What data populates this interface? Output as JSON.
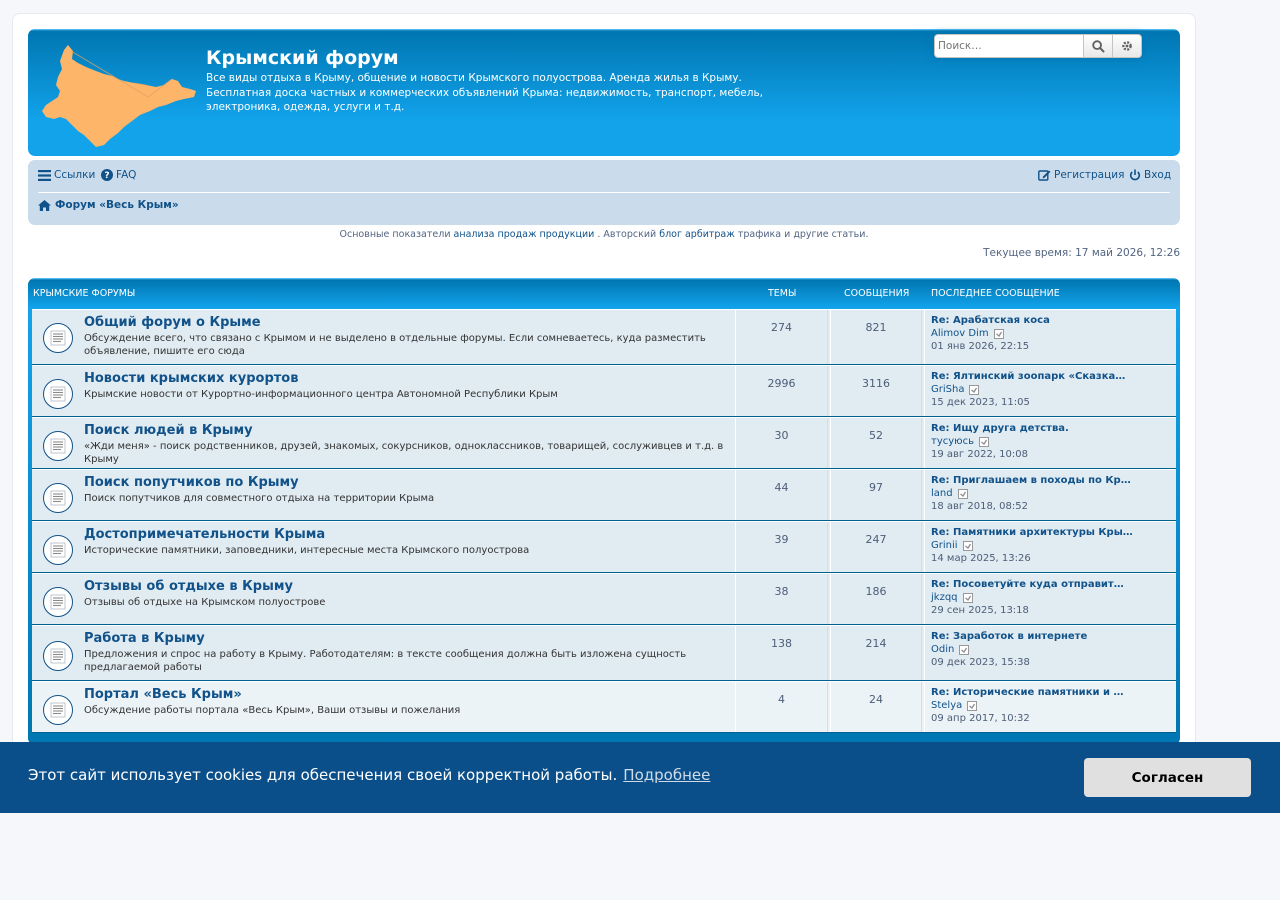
{
  "header": {
    "title": "Крымский форум",
    "description": "Все виды отдыха в Крыму, общение и новости Крымского полуострова. Аренда жилья в Крыму. Бесплатная доска частных и коммерческих объявлений Крыма: недвижимость, транспорт, мебель, электроника, одежда, услуги и т.д.",
    "logo": "crimea-map-logo",
    "search_placeholder": "Поиск…"
  },
  "nav": {
    "links_label": "Ссылки",
    "faq_label": "FAQ",
    "register_label": "Регистрация",
    "login_label": "Вход",
    "breadcrumb": "Форум «Весь Крым»"
  },
  "promo": {
    "prefix": "Основные показатели",
    "link1": "анализа продаж продукции",
    "middle": ". Авторский",
    "link2": "блог арбитраж",
    "suffix": "трафика и другие статьи."
  },
  "current_time": "Текущее время: 17 май 2026, 12:26",
  "forum_table": {
    "headers": {
      "category": "Крымские форумы",
      "topics": "Темы",
      "posts": "Сообщения",
      "last_post": "Последнее сообщение"
    },
    "rows": [
      {
        "title": "Общий форум о Крыме",
        "desc": "Обсуждение всего, что связано с Крымом и не выделено в отдельные форумы. Если сомневаетесь, куда разместить объявление, пишите его сюда",
        "topics": "274",
        "posts": "821",
        "last_title": "Re: Арабатская коса",
        "last_user": "Alimov Dim",
        "last_date": "01 янв 2026, 22:15"
      },
      {
        "title": "Новости крымских курортов",
        "desc": "Крымские новости от Курортно-информационного центра Автономной Республики Крым",
        "topics": "2996",
        "posts": "3116",
        "last_title": "Re: Ялтинский зоопарк «Сказка…",
        "last_user": "GriSha",
        "last_date": "15 дек 2023, 11:05"
      },
      {
        "title": "Поиск людей в Крыму",
        "desc": "«Жди меня» - поиск родственников, друзей, знакомых, сокурсников, одноклассников, товарищей, сослуживцев и т.д. в Крыму",
        "topics": "30",
        "posts": "52",
        "last_title": "Re: Ищу друга детства.",
        "last_user": "тусуюсь",
        "last_date": "19 авг 2022, 10:08"
      },
      {
        "title": "Поиск попутчиков по Крыму",
        "desc": "Поиск попутчиков для совместного отдыха на территории Крыма",
        "topics": "44",
        "posts": "97",
        "last_title": "Re: Приглашаем в походы по Кр…",
        "last_user": "land",
        "last_date": "18 авг 2018, 08:52"
      },
      {
        "title": "Достопримечательности Крыма",
        "desc": "Исторические памятники, заповедники, интересные места Крымского полуострова",
        "topics": "39",
        "posts": "247",
        "last_title": "Re: Памятники архитектуры Кры…",
        "last_user": "Grinii",
        "last_date": "14 мар 2025, 13:26"
      },
      {
        "title": "Отзывы об отдыхе в Крыму",
        "desc": "Отзывы об отдыхе на Крымском полуострове",
        "topics": "38",
        "posts": "186",
        "last_title": "Re: Посоветуйте куда отправит…",
        "last_user": "jkzqq",
        "last_date": "29 сен 2025, 13:18"
      },
      {
        "title": "Работа в Крыму",
        "desc": "Предложения и спрос на работу в Крыму. Работодателям: в тексте сообщения должна быть изложена сущность предлагаемой работы",
        "topics": "138",
        "posts": "214",
        "last_title": "Re: Заработок в интернете",
        "last_user": "Odin",
        "last_date": "09 дек 2023, 15:38"
      },
      {
        "title": "Портал «Весь Крым»",
        "desc": "Обсуждение работы портала «Весь Крым», Ваши отзывы и пожелания",
        "topics": "4",
        "posts": "24",
        "last_title": "Re: Исторические памятники и …",
        "last_user": "Stelya",
        "last_date": "09 апр 2017, 10:32"
      }
    ]
  },
  "cookie_banner": {
    "message": "Этот сайт использует cookies для обеспечения своей корректной работы.",
    "link": "Подробнее",
    "accept": "Согласен"
  },
  "colors": {
    "header_blue": "#12a3eb",
    "nav_bg": "#cadceb",
    "link": "#105289",
    "cookie_bg": "#0b4f8a",
    "logo_fill": "#fdb56a"
  }
}
